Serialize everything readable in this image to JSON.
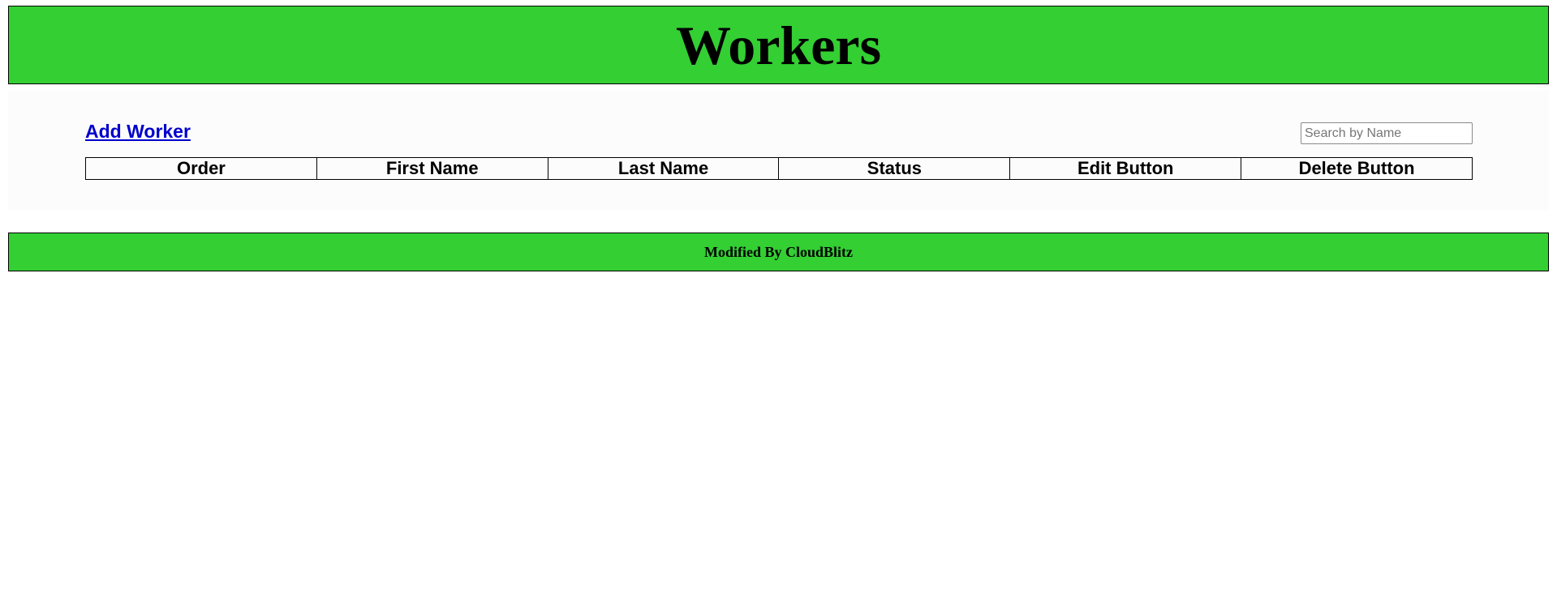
{
  "header": {
    "title": "Workers"
  },
  "toolbar": {
    "add_worker_label": "Add Worker",
    "search": {
      "value": "",
      "placeholder": "Search by Name"
    }
  },
  "table": {
    "columns": [
      "Order",
      "First Name",
      "Last Name",
      "Status",
      "Edit Button",
      "Delete Button"
    ],
    "rows": []
  },
  "footer": {
    "text": "Modified By CloudBlitz"
  },
  "colors": {
    "header_bg": "#33cf33",
    "footer_bg": "#33cf33",
    "link": "#0000cc",
    "content_bg": "#fcfcfc"
  }
}
